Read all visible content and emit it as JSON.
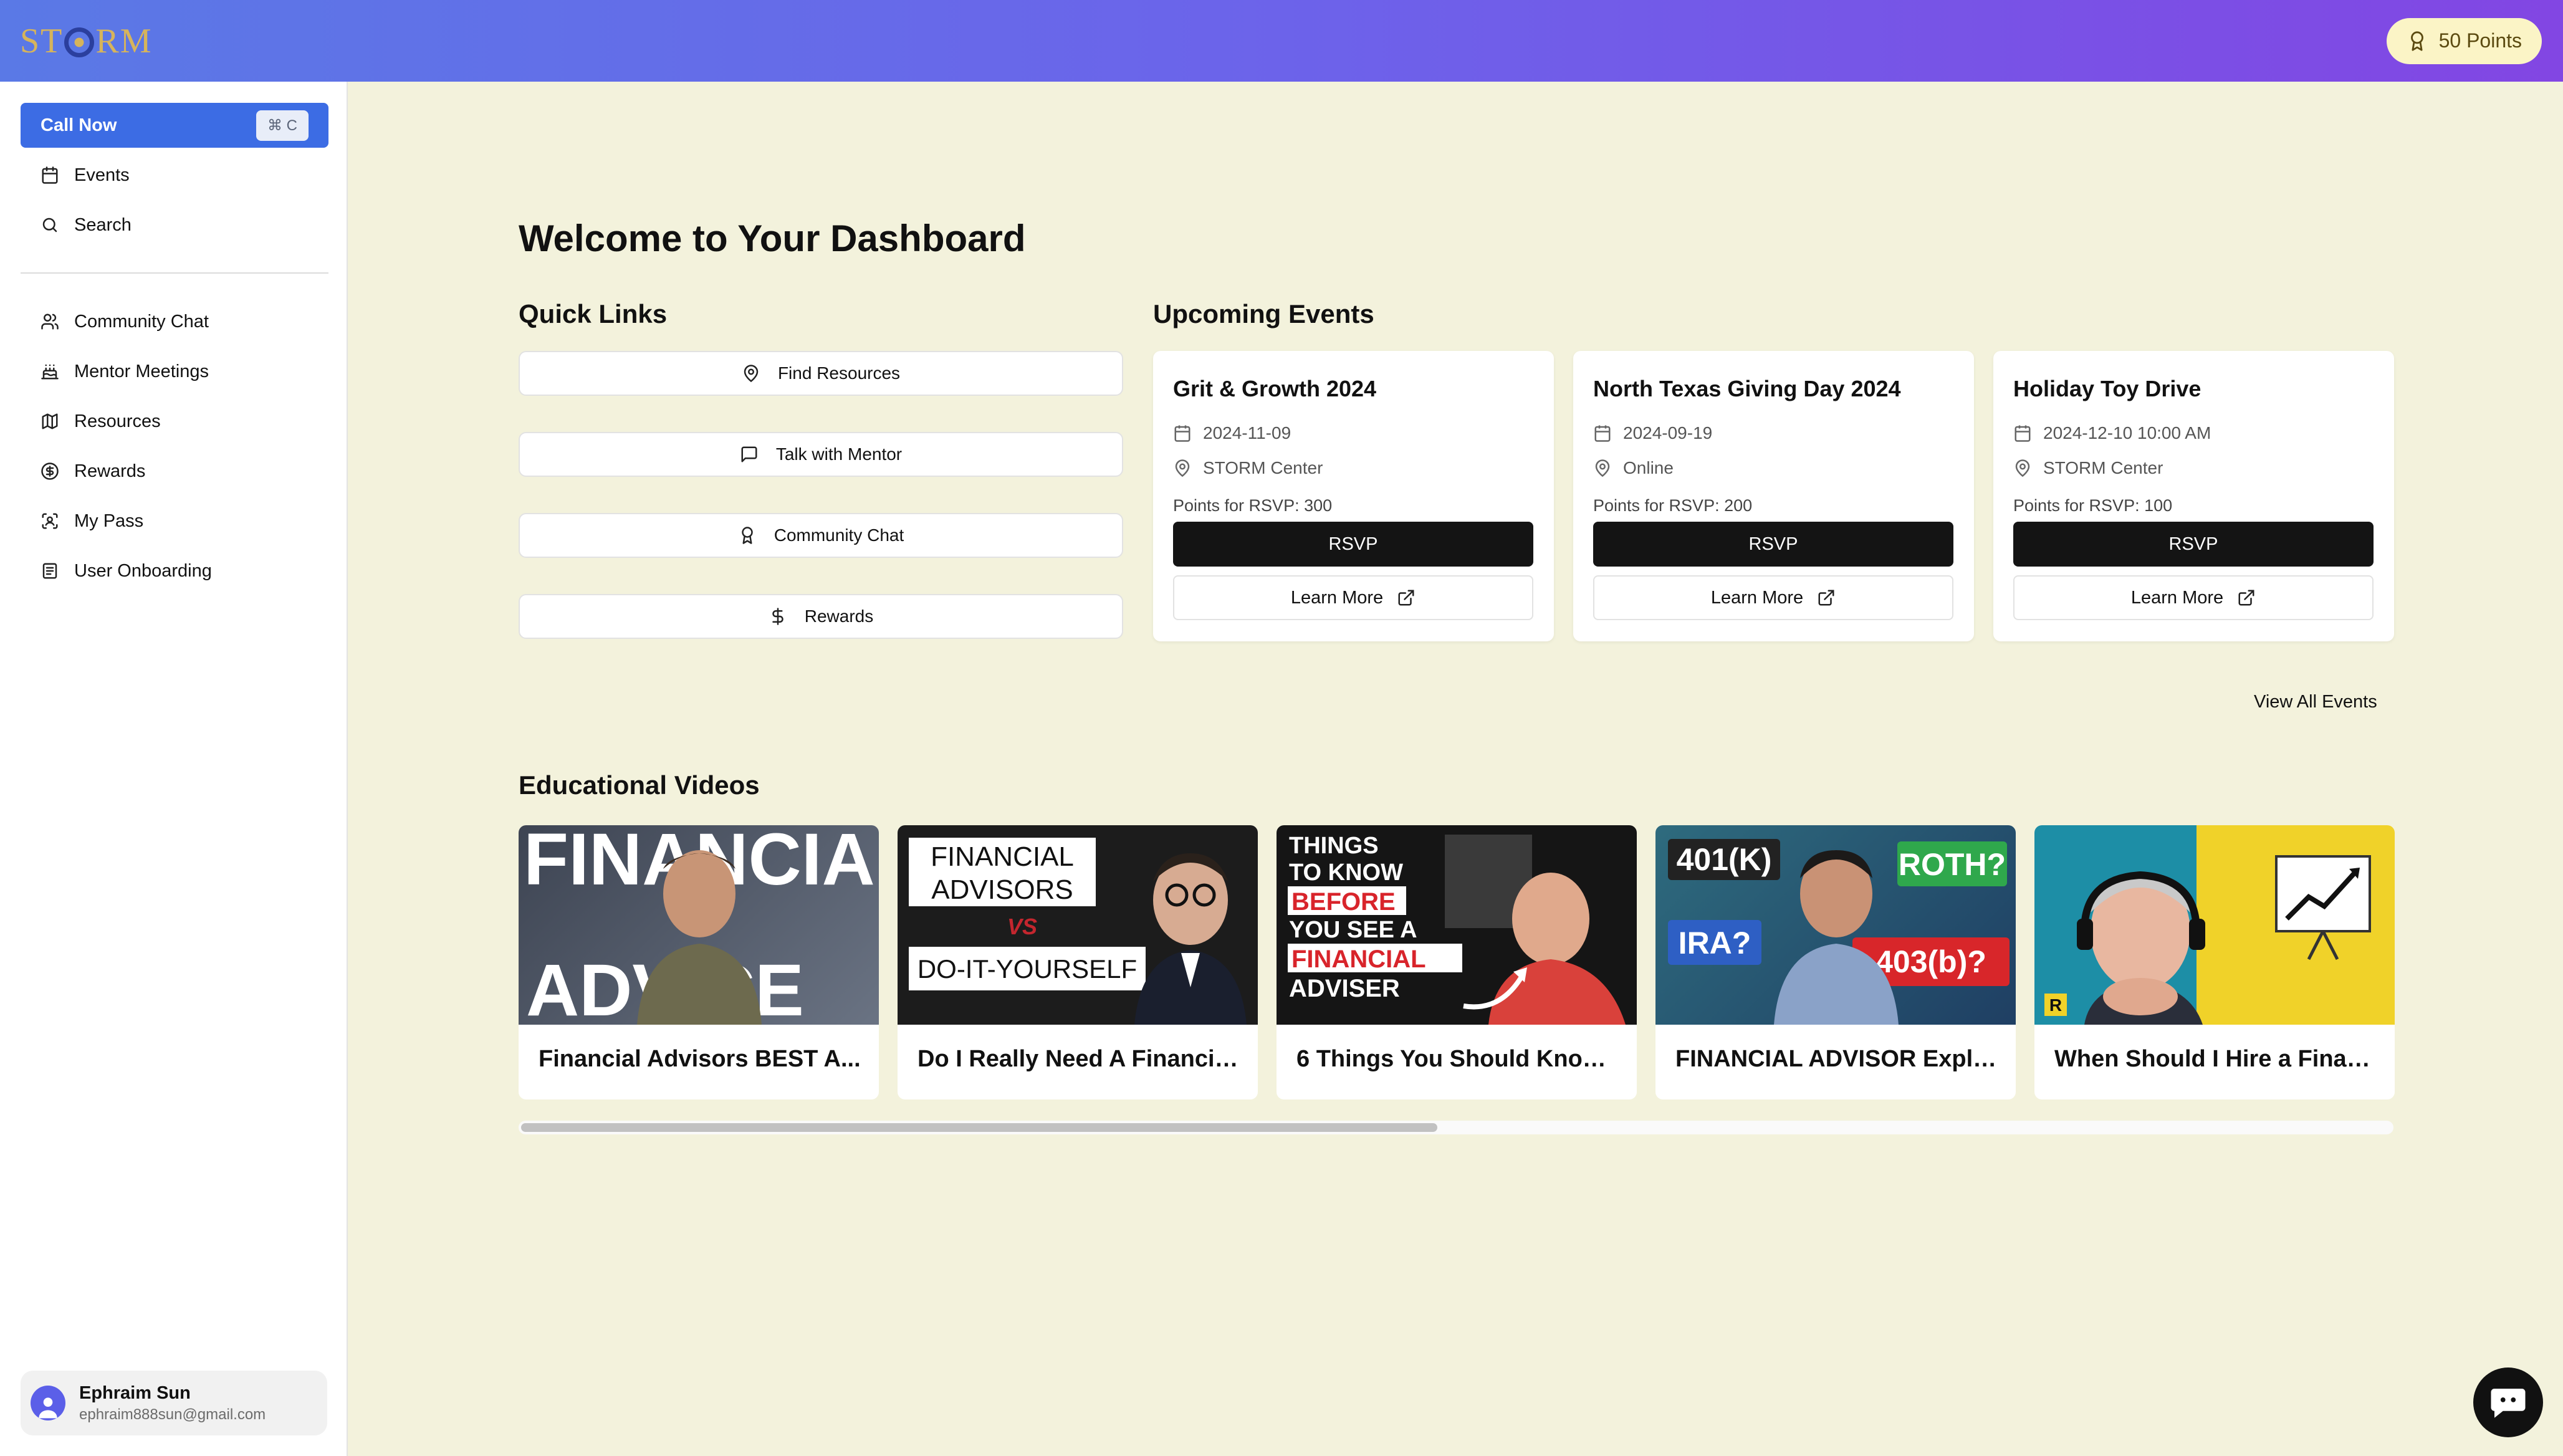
{
  "header": {
    "logo_text": "STORM",
    "points_label": "50 Points"
  },
  "sidebar": {
    "call_now": {
      "label": "Call Now",
      "shortcut": "⌘ C"
    },
    "items": [
      {
        "label": "Events",
        "icon": "calendar-icon"
      },
      {
        "label": "Search",
        "icon": "search-icon"
      },
      {
        "label": "Community Chat",
        "icon": "users-icon"
      },
      {
        "label": "Mentor Meetings",
        "icon": "cake-icon"
      },
      {
        "label": "Resources",
        "icon": "map-icon"
      },
      {
        "label": "Rewards",
        "icon": "dollar-circle-icon"
      },
      {
        "label": "My Pass",
        "icon": "scan-icon"
      },
      {
        "label": "User Onboarding",
        "icon": "clipboard-icon"
      }
    ],
    "user": {
      "name": "Ephraim Sun",
      "email": "ephraim888sun@gmail.com"
    }
  },
  "main": {
    "title": "Welcome to Your Dashboard",
    "quick_links": {
      "title": "Quick Links",
      "items": [
        {
          "label": "Find Resources",
          "icon": "map-pin-icon"
        },
        {
          "label": "Talk with Mentor",
          "icon": "message-square-icon"
        },
        {
          "label": "Community Chat",
          "icon": "award-icon"
        },
        {
          "label": "Rewards",
          "icon": "dollar-icon"
        }
      ]
    },
    "events": {
      "title": "Upcoming Events",
      "items": [
        {
          "title": "Grit & Growth 2024",
          "date": "2024-11-09",
          "location": "STORM Center",
          "points": "Points for RSVP: 300",
          "rsvp": "RSVP",
          "learn_more": "Learn More"
        },
        {
          "title": "North Texas Giving Day 2024",
          "date": "2024-09-19",
          "location": "Online",
          "points": "Points for RSVP: 200",
          "rsvp": "RSVP",
          "learn_more": "Learn More"
        },
        {
          "title": "Holiday Toy Drive",
          "date": "2024-12-10 10:00 AM",
          "location": "STORM Center",
          "points": "Points for RSVP: 100",
          "rsvp": "RSVP",
          "learn_more": "Learn More"
        }
      ],
      "view_all": "View All Events"
    },
    "videos": {
      "title": "Educational Videos",
      "items": [
        {
          "title": "Financial Advisors BEST A...",
          "thumb_text": [
            "FINANCIAL",
            "ADVICE"
          ]
        },
        {
          "title": "Do I Really Need A Financia...",
          "thumb_text": [
            "FINANCIAL",
            "ADVISORS",
            "VS",
            "DO-IT-YOURSELF"
          ]
        },
        {
          "title": "6 Things You Should Know ...",
          "thumb_text": [
            "THINGS",
            "TO KNOW",
            "BEFORE",
            "YOU SEE A",
            "FINANCIAL",
            "ADVISER"
          ]
        },
        {
          "title": "FINANCIAL ADVISOR Expla...",
          "thumb_text": [
            "401(K)",
            "ROTH?",
            "IRA?",
            "403(b)?"
          ]
        },
        {
          "title": "When Should I Hire a Finan...",
          "thumb_text": [
            "R"
          ]
        }
      ],
      "scroll_progress": 0.49
    }
  },
  "colors": {
    "page_bg": "#f3f2dc",
    "header_gradient_start": "#5a79e6",
    "header_gradient_end": "#8246e3",
    "primary": "#3c6ce4",
    "button_dark": "#141414"
  }
}
